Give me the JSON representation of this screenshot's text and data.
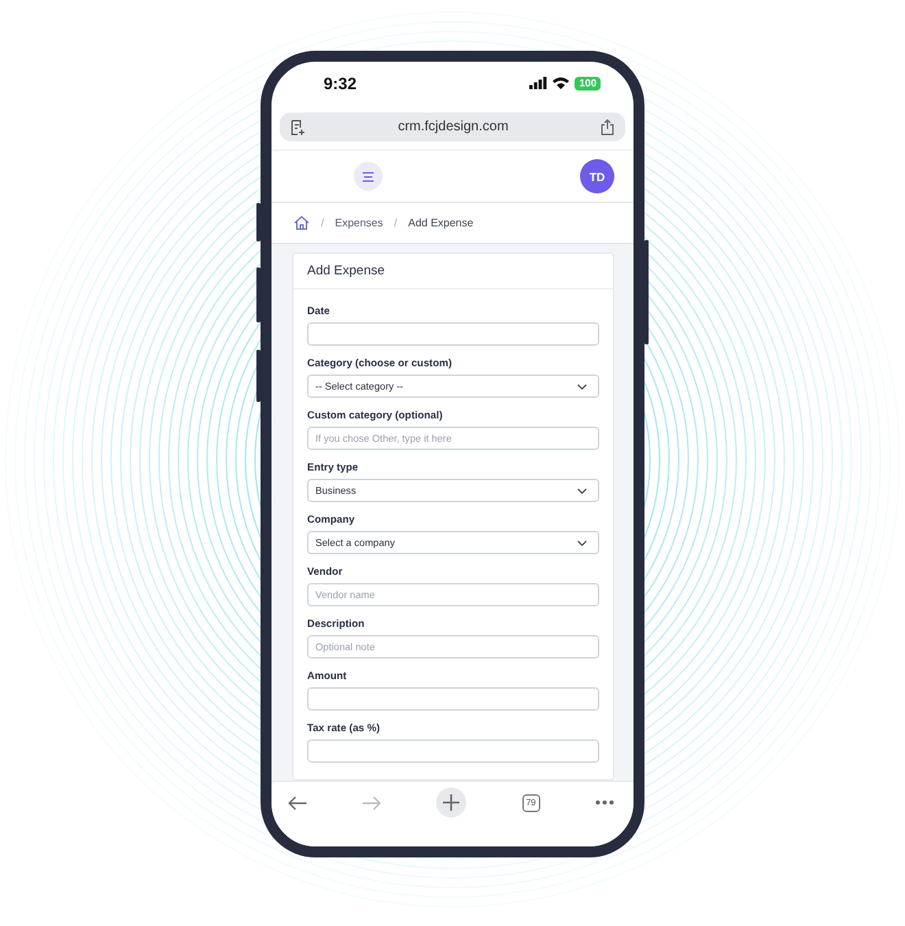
{
  "status_bar": {
    "time": "9:32",
    "battery": "100"
  },
  "browser": {
    "url": "crm.fcjdesign.com",
    "tab_count": "79"
  },
  "header": {
    "avatar": "TD"
  },
  "breadcrumb": [
    {
      "separator": "/",
      "label": "Expenses"
    },
    {
      "separator": "/",
      "label": "Add Expense"
    }
  ],
  "form": {
    "title": "Add Expense",
    "fields": [
      {
        "label": "Date",
        "kind": "input"
      },
      {
        "label": "Category (choose or custom)",
        "kind": "select",
        "value": "-- Select category --"
      },
      {
        "label": "Custom category (optional)",
        "kind": "input",
        "placeholder": "If you chose Other, type it here"
      },
      {
        "label": "Entry type",
        "kind": "select",
        "value": "Business"
      },
      {
        "label": "Company",
        "kind": "select",
        "value": "Select a company"
      },
      {
        "label": "Vendor",
        "kind": "input",
        "placeholder": "Vendor name"
      },
      {
        "label": "Description",
        "kind": "input",
        "placeholder": "Optional note"
      },
      {
        "label": "Amount",
        "kind": "input"
      },
      {
        "label": "Tax rate (as %)",
        "kind": "input"
      }
    ]
  }
}
